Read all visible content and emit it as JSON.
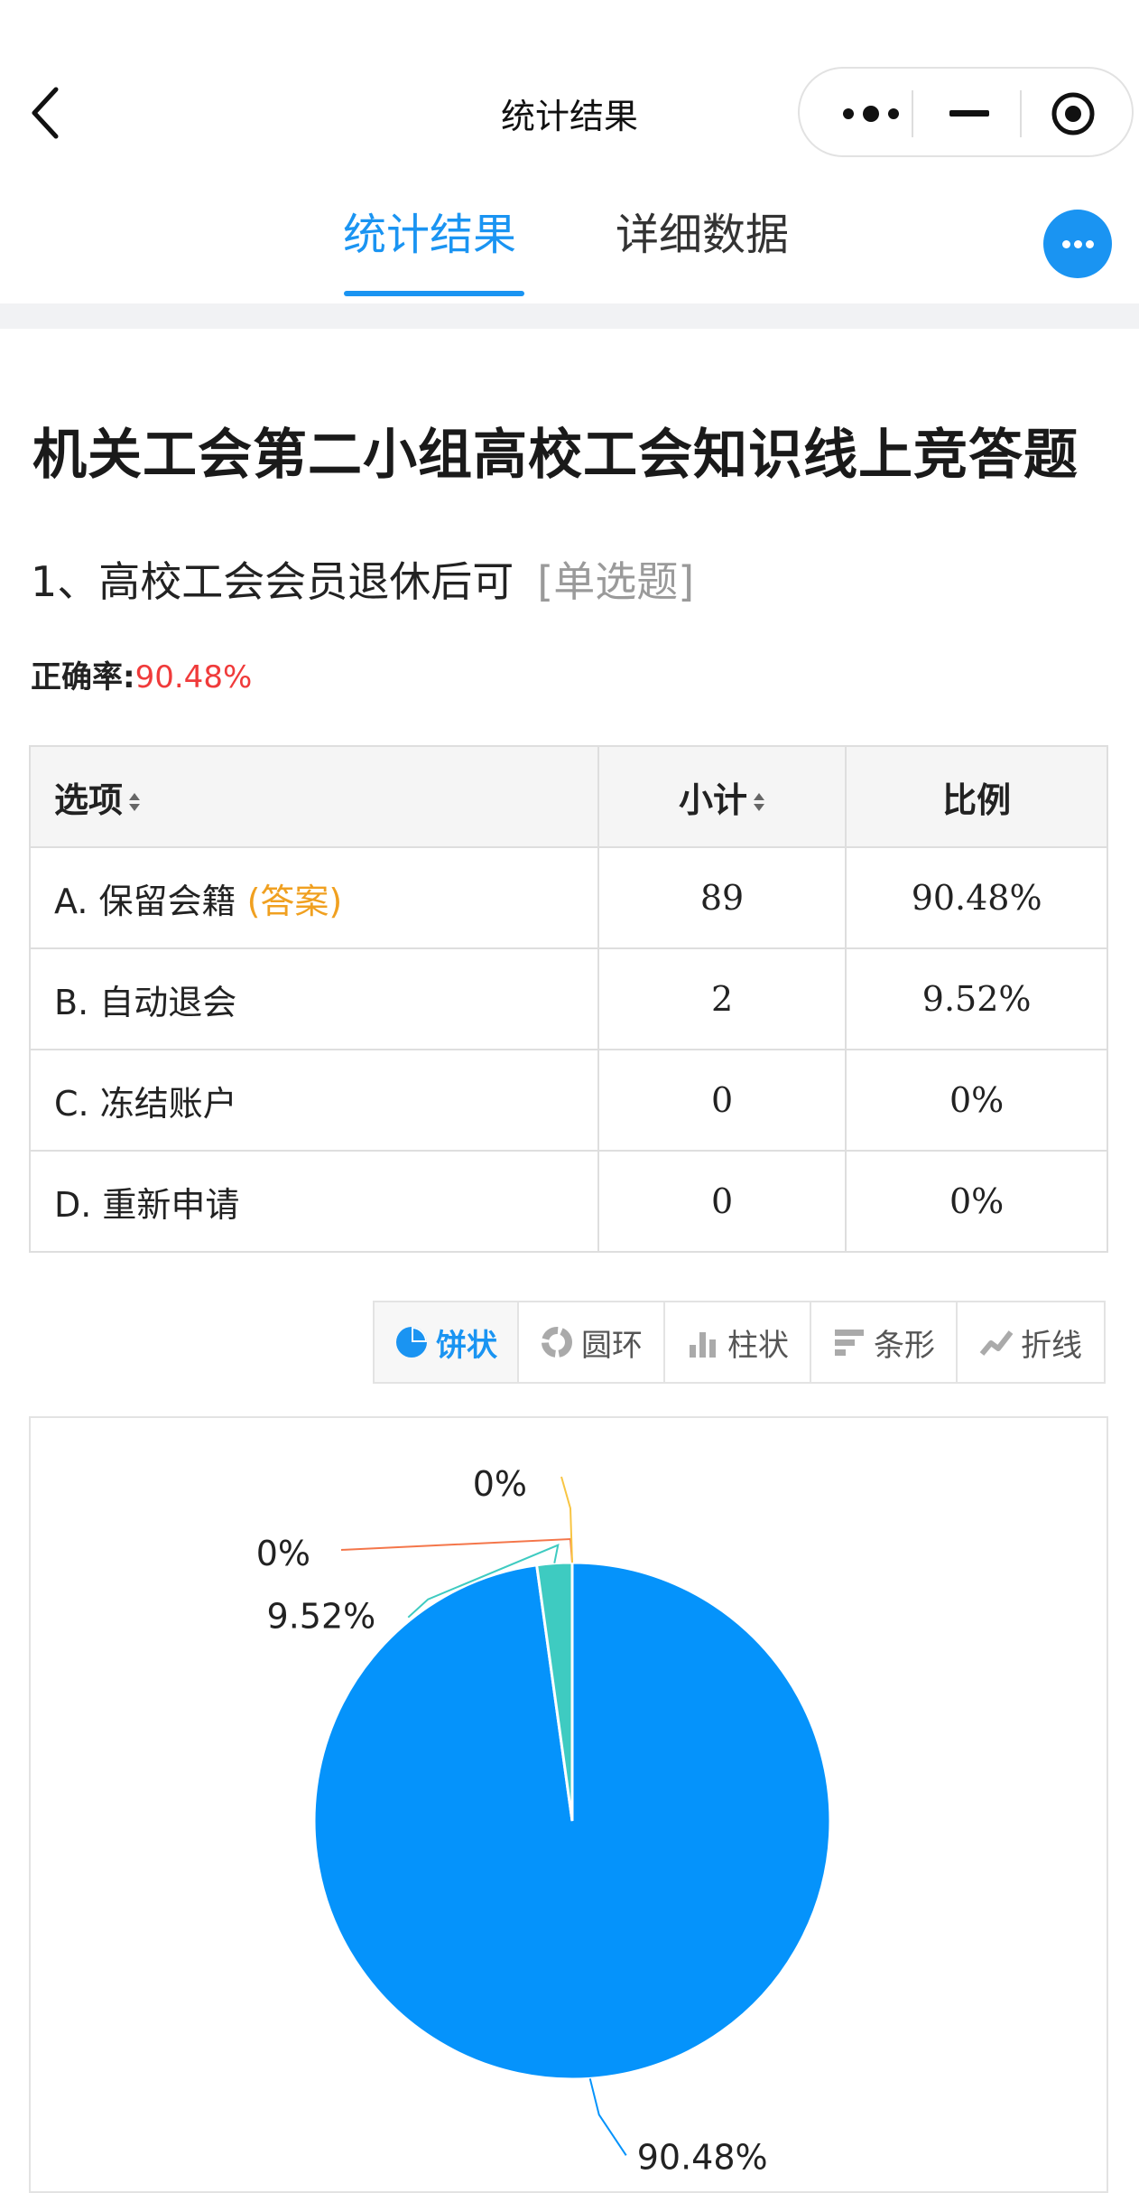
{
  "nav": {
    "title": "统计结果"
  },
  "tabs": [
    {
      "label": "统计结果",
      "active": true
    },
    {
      "label": "详细数据",
      "active": false
    }
  ],
  "survey": {
    "title": "机关工会第二小组高校工会知识线上竞答题"
  },
  "question": {
    "text": "1、高校工会会员退休后可",
    "type_tag": "[单选题]",
    "accuracy_label": "正确率:",
    "accuracy_value": "90.48%"
  },
  "table": {
    "headers": [
      "选项",
      "小计",
      "比例"
    ],
    "rows": [
      {
        "option": "A. 保留会籍",
        "answer_tag": "(答案)",
        "count": "89",
        "ratio": "90.48%"
      },
      {
        "option": "B. 自动退会",
        "answer_tag": "",
        "count": "2",
        "ratio": "9.52%"
      },
      {
        "option": "C. 冻结账户",
        "answer_tag": "",
        "count": "0",
        "ratio": "0%"
      },
      {
        "option": "D. 重新申请",
        "answer_tag": "",
        "count": "0",
        "ratio": "0%"
      }
    ]
  },
  "chart_switcher": [
    {
      "label": "饼状",
      "icon": "pie-icon",
      "active": true
    },
    {
      "label": "圆环",
      "icon": "donut-icon",
      "active": false
    },
    {
      "label": "柱状",
      "icon": "column-icon",
      "active": false
    },
    {
      "label": "条形",
      "icon": "bar-icon",
      "active": false
    },
    {
      "label": "折线",
      "icon": "line-icon",
      "active": false
    }
  ],
  "colors": {
    "accent": "#1a94f2",
    "accuracy": "#f03b3b",
    "answer_tag": "#f0a020"
  },
  "chart_data": {
    "type": "pie",
    "categories": [
      "A. 保留会籍",
      "B. 自动退会",
      "C. 冻结账户",
      "D. 重新申请"
    ],
    "values": [
      89,
      2,
      0,
      0
    ],
    "labels": [
      "90.48%",
      "9.52%",
      "0%",
      "0%"
    ],
    "colors": [
      "#0593fb",
      "#3ecbc1",
      "#f4764a",
      "#f8c543"
    ]
  }
}
